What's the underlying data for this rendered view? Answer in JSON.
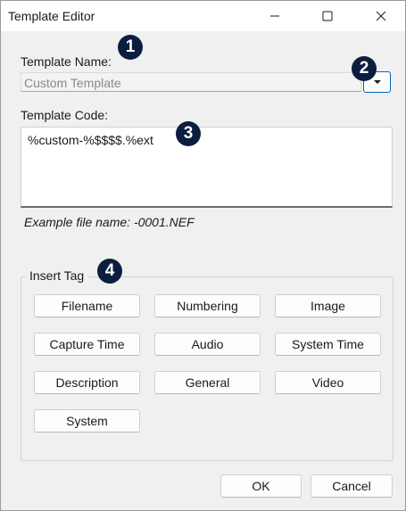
{
  "window": {
    "title": "Template Editor"
  },
  "template_name": {
    "label": "Template Name:",
    "value": "Custom Template"
  },
  "template_code": {
    "label": "Template Code:",
    "value": "%custom-%$$$$.%ext"
  },
  "example": "Example file name: -0001.NEF",
  "insert_tag": {
    "label": "Insert Tag",
    "tags": [
      "Filename",
      "Numbering",
      "Image",
      "Capture Time",
      "Audio",
      "System Time",
      "Description",
      "General",
      "Video",
      "System"
    ]
  },
  "buttons": {
    "ok": "OK",
    "cancel": "Cancel"
  },
  "callouts": [
    "1",
    "2",
    "3",
    "4"
  ],
  "colors": {
    "callout_bg": "#0b1e3f",
    "accent": "#0067c0"
  }
}
